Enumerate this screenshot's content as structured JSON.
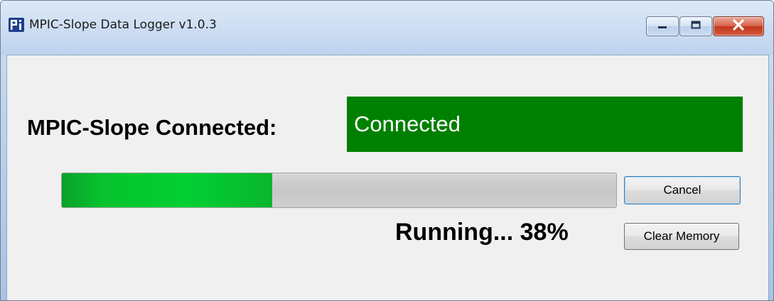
{
  "window": {
    "title": "MPIC-Slope Data Logger  v1.0.3",
    "icon": "app-icon",
    "controls": {
      "minimize_icon": "minimize-icon",
      "maximize_icon": "maximize-icon",
      "close_icon": "close-icon"
    }
  },
  "connection": {
    "label": "MPIC-Slope Connected:",
    "status": "Connected",
    "status_color": "#008000"
  },
  "progress": {
    "percent": 38,
    "status_text": "Running... 38%",
    "fill_color": "#00d033"
  },
  "buttons": {
    "cancel": "Cancel",
    "clear_memory": "Clear Memory"
  }
}
